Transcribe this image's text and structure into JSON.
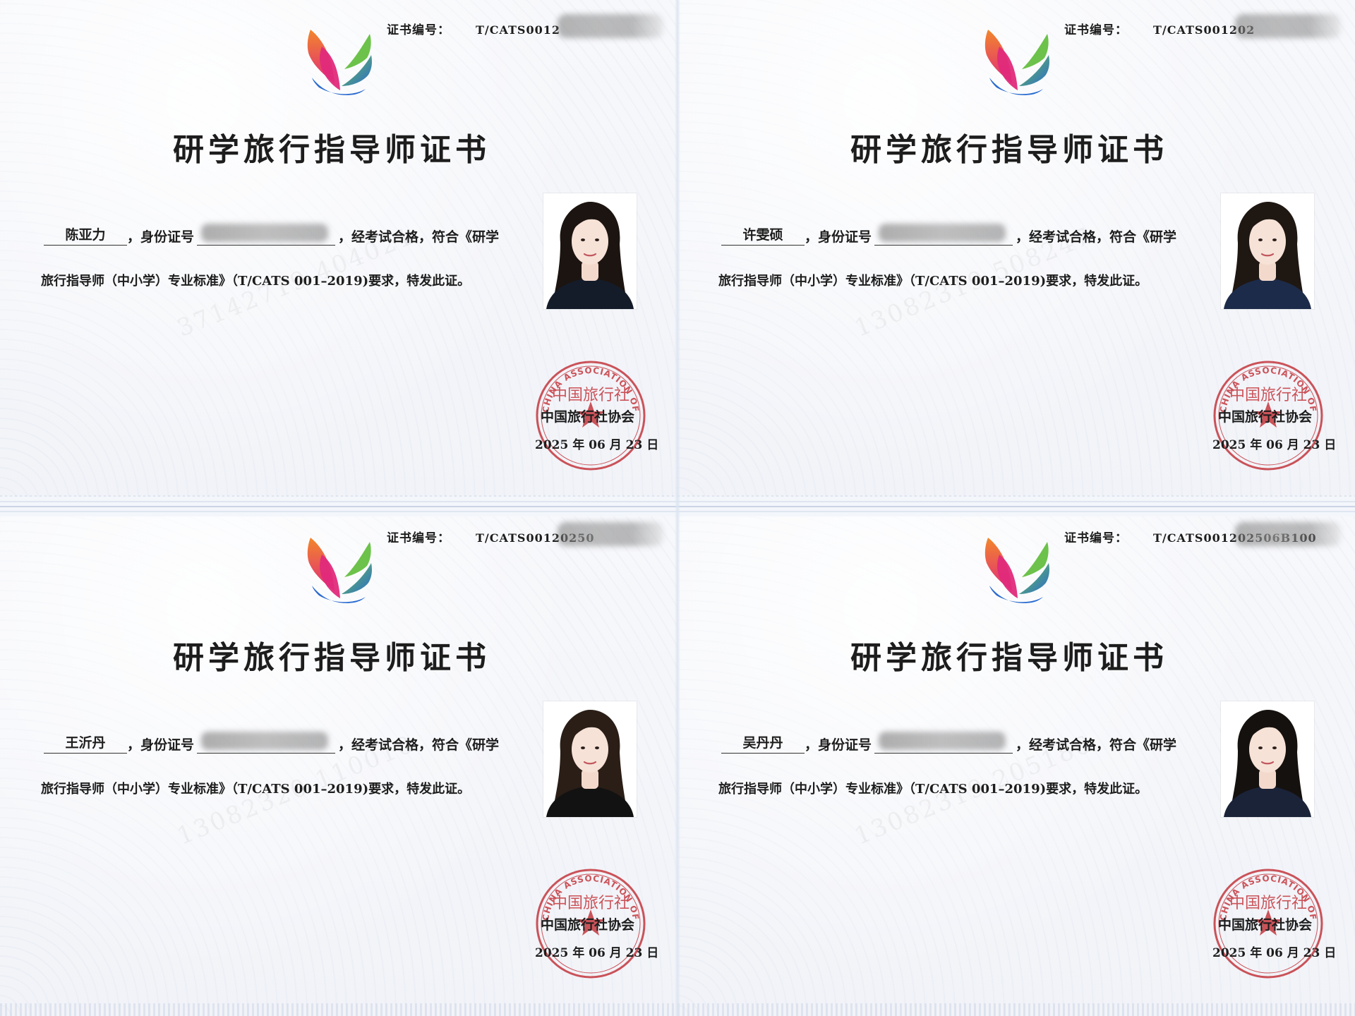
{
  "common": {
    "cert_no_label": "证书编号：",
    "title": "研学旅行指导师证书",
    "id_label": "，身份证号",
    "line1_tail": "，经考试合格，符合《研学",
    "line2": "旅行指导师（中小学）专业标准》（T/CATS 001–2019)要求，特发此证。",
    "org": "中国旅行社协会",
    "date": "2025 年 06 月 23 日",
    "seal_ring_text": "CHINA ASSOCIATION OF TRAVEL SERVICES",
    "seal_inner_text": "中国旅行社",
    "brand_colors": {
      "seal_red": "#c4373e",
      "logo_orange": "#f2872a",
      "logo_pink": "#e02a7b",
      "logo_blue": "#2a6bd0",
      "logo_green": "#6cc24a"
    }
  },
  "certificates": [
    {
      "name": "陈亚力",
      "cert_no_visible": "T/CATS0012",
      "watermark": "37142719 404021",
      "photo": {
        "hair": "#1c1410",
        "cloth": "#141c2a",
        "bg": "#ffffff"
      }
    },
    {
      "name": "许雯硕",
      "cert_no_visible": "T/CATS001202",
      "watermark": "13082319 508247",
      "photo": {
        "hair": "#1f1712",
        "cloth": "#1d2b4a",
        "bg": "#ffffff"
      }
    },
    {
      "name": "王沂丹",
      "cert_no_visible": "T/CATS00120250",
      "watermark": "13082320 110010",
      "photo": {
        "hair": "#2a1e17",
        "cloth": "#121212",
        "bg": "#ffffff"
      }
    },
    {
      "name": "吴丹丹",
      "cert_no_visible": "T/CATS001202506B100",
      "watermark": "13082319 205186",
      "photo": {
        "hair": "#15110f",
        "cloth": "#1a2338",
        "bg": "#ffffff"
      }
    }
  ]
}
